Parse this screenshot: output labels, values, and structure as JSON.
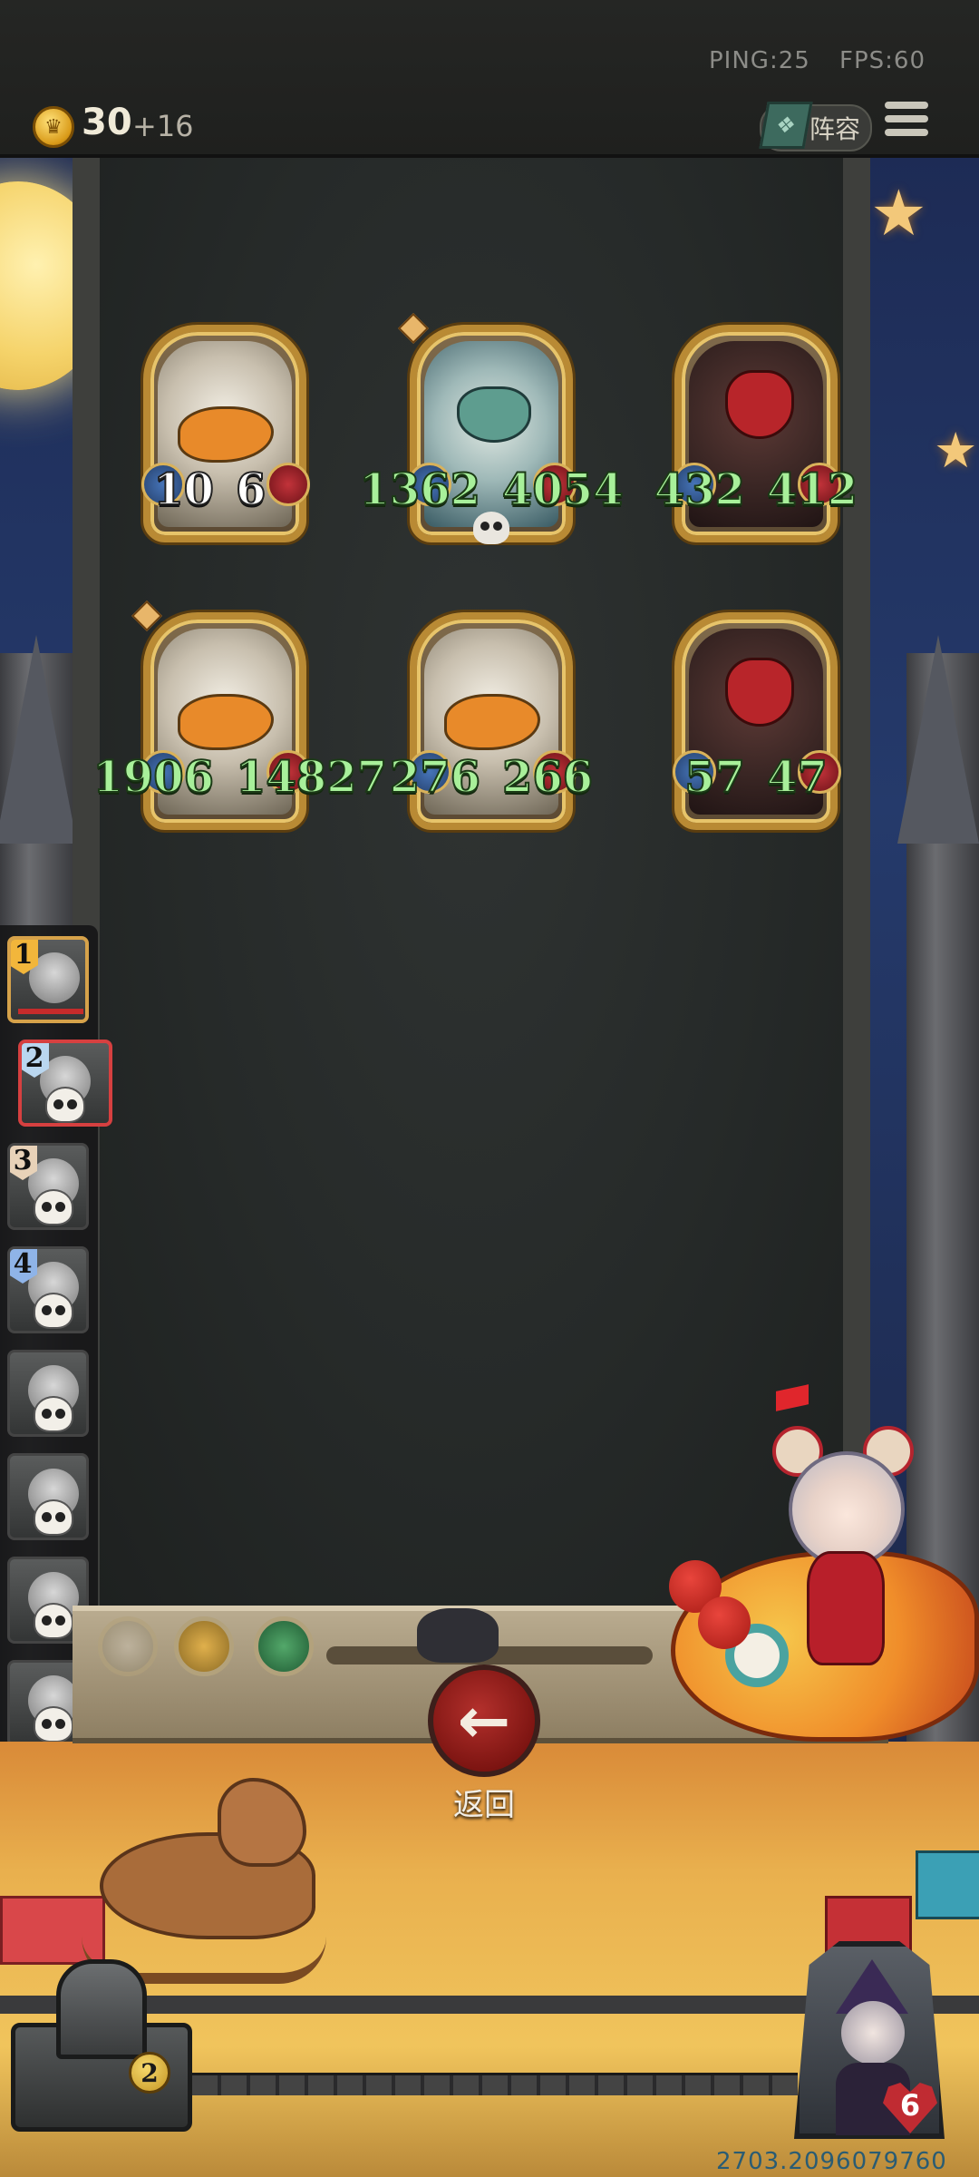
{
  "hud": {
    "ping": "PING:25",
    "fps": "FPS:60",
    "gold": "30",
    "gold_income": "+16",
    "lineup_label": "阵容"
  },
  "board_units": [
    {
      "attack": "10",
      "health": "6",
      "portrait": "pelican"
    },
    {
      "attack": "1362",
      "health": "4054",
      "portrait": "mantis"
    },
    {
      "attack": "432",
      "health": "412",
      "portrait": "demon"
    },
    {
      "attack": "1906",
      "health": "14827",
      "portrait": "pelican"
    },
    {
      "attack": "276",
      "health": "266",
      "portrait": "pelican"
    },
    {
      "attack": "57",
      "health": "47",
      "portrait": "demon"
    }
  ],
  "players": [
    {
      "rank": "1",
      "state": "active"
    },
    {
      "rank": "2",
      "state": "selected, eliminated"
    },
    {
      "rank": "3",
      "state": "eliminated"
    },
    {
      "rank": "4",
      "state": "eliminated"
    },
    {
      "rank": "",
      "state": "eliminated"
    },
    {
      "rank": "",
      "state": "eliminated"
    },
    {
      "rank": "",
      "state": "eliminated"
    },
    {
      "rank": "",
      "state": "eliminated"
    }
  ],
  "actions": {
    "back_label": "返回",
    "back_icon": "←"
  },
  "treasure": {
    "count": "2"
  },
  "player": {
    "hp": "6",
    "uid": "2703.2096079760"
  },
  "colors": {
    "stat_text": "#a8f09a",
    "gold_accent": "#d99a18",
    "back_button": "#b3302c"
  }
}
